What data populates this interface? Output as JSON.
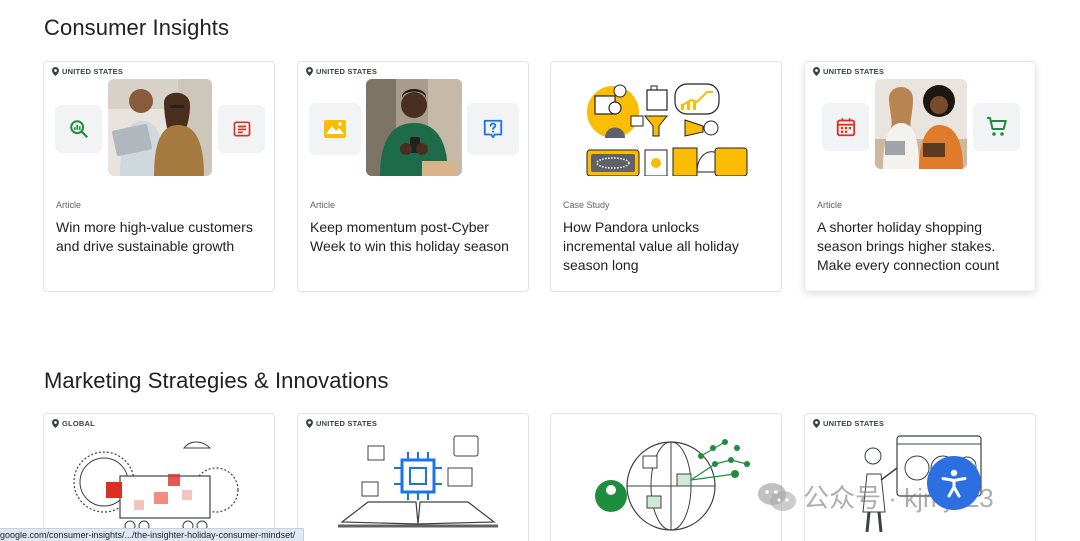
{
  "sections": [
    {
      "title": "Consumer Insights",
      "cards": [
        {
          "location": "UNITED STATES",
          "type": "Article",
          "headline": "Win more high-value customers and drive sustainable growth"
        },
        {
          "location": "UNITED STATES",
          "type": "Article",
          "headline": "Keep momentum post-Cyber Week to win this holiday season"
        },
        {
          "location": "",
          "type": "Case Study",
          "headline": "How Pandora unlocks incremental value all holiday season long"
        },
        {
          "location": "UNITED STATES",
          "type": "Article",
          "headline": "A shorter holiday shopping season brings higher stakes. Make every connection count"
        }
      ]
    },
    {
      "title": "Marketing Strategies & Innovations",
      "cards": [
        {
          "location": "GLOBAL"
        },
        {
          "location": "UNITED STATES"
        },
        {
          "location": ""
        },
        {
          "location": "UNITED STATES"
        }
      ]
    }
  ],
  "status_bar": {
    "url": "google.com/consumer-insights/.../the-insighter-holiday-consumer-mindset/"
  },
  "watermark": {
    "text": "公众号 · kjmj123"
  },
  "icons": {
    "card1_left": "analytics-search-icon",
    "card1_right": "article-icon",
    "card2_left": "landscape-icon",
    "card2_right": "help-icon",
    "card4_left": "calendar-icon",
    "card4_right": "shopping-cart-icon",
    "accessibility": "accessibility-icon"
  },
  "colors": {
    "green": "#1e8e3e",
    "red": "#d93025",
    "yellow": "#fbbc04",
    "blue": "#1a73e8",
    "accessibility_bg": "#2c6fe0"
  }
}
